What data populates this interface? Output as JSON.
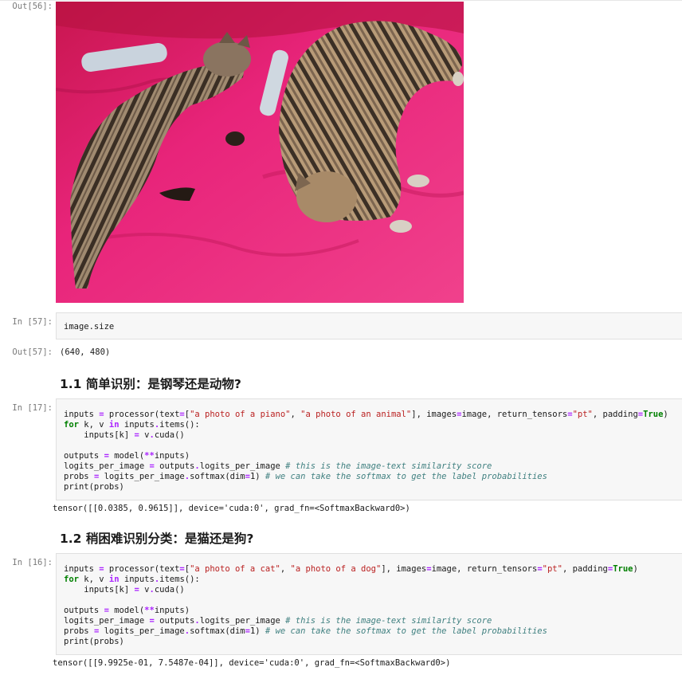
{
  "colors": {
    "prompt": "#7a7a7a",
    "code_bg": "#f7f7f7",
    "keyword": "#008000",
    "string": "#ba2121",
    "operator": "#aa22ff",
    "comment": "#408080",
    "blanket": "#e0216f"
  },
  "cells": {
    "out56": {
      "prompt": "Out[56]:",
      "image_alt": "two tabby cats lying on a pink blanket with two remote controls"
    },
    "in57": {
      "prompt": "In [57]:",
      "code": "image.size"
    },
    "out57": {
      "prompt": "Out[57]:",
      "text": "(640, 480)"
    },
    "heading1": {
      "text": "1.1 简单识别：是钢琴还是动物?"
    },
    "in17": {
      "prompt": "In [17]:",
      "l1_a": "inputs ",
      "l1_b": "=",
      "l1_c": " processor(text",
      "l1_d": "=",
      "l1_e": "[",
      "l1_f": "\"a photo of a piano\"",
      "l1_g": ", ",
      "l1_h": "\"a photo of an animal\"",
      "l1_i": "], images",
      "l1_j": "=",
      "l1_k": "image, return_tensors",
      "l1_l": "=",
      "l1_m": "\"pt\"",
      "l1_n": ", padding",
      "l1_o": "=",
      "l1_p": "True",
      "l1_q": ")",
      "l2_a": "for",
      "l2_b": " k, v ",
      "l2_c": "in",
      "l2_d": " inputs",
      "l2_e": ".",
      "l2_f": "items():",
      "l3_a": "    inputs[k] ",
      "l3_b": "=",
      "l3_c": " v",
      "l3_d": ".",
      "l3_e": "cuda()",
      "l5_a": "outputs ",
      "l5_b": "=",
      "l5_c": " model(",
      "l5_d": "**",
      "l5_e": "inputs)",
      "l6_a": "logits_per_image ",
      "l6_b": "=",
      "l6_c": " outputs",
      "l6_d": ".",
      "l6_e": "logits_per_image ",
      "l6_f": "# this is the image-text similarity score",
      "l7_a": "probs ",
      "l7_b": "=",
      "l7_c": " logits_per_image",
      "l7_d": ".",
      "l7_e": "softmax(dim",
      "l7_f": "=",
      "l7_g": "1",
      "l7_h": ") ",
      "l7_i": "# we can take the softmax to get the label probabilities",
      "l8_a": "print",
      "l8_b": "(probs)"
    },
    "out17": {
      "text": "tensor([[0.0385, 0.9615]], device='cuda:0', grad_fn=<SoftmaxBackward0>)"
    },
    "heading2": {
      "text": "1.2 稍困难识别分类：是猫还是狗?"
    },
    "in16": {
      "prompt": "In [16]:",
      "l1_a": "inputs ",
      "l1_b": "=",
      "l1_c": " processor(text",
      "l1_d": "=",
      "l1_e": "[",
      "l1_f": "\"a photo of a cat\"",
      "l1_g": ", ",
      "l1_h": "\"a photo of a dog\"",
      "l1_i": "], images",
      "l1_j": "=",
      "l1_k": "image, return_tensors",
      "l1_l": "=",
      "l1_m": "\"pt\"",
      "l1_n": ", padding",
      "l1_o": "=",
      "l1_p": "True",
      "l1_q": ")",
      "l2_a": "for",
      "l2_b": " k, v ",
      "l2_c": "in",
      "l2_d": " inputs",
      "l2_e": ".",
      "l2_f": "items():",
      "l3_a": "    inputs[k] ",
      "l3_b": "=",
      "l3_c": " v",
      "l3_d": ".",
      "l3_e": "cuda()",
      "l5_a": "outputs ",
      "l5_b": "=",
      "l5_c": " model(",
      "l5_d": "**",
      "l5_e": "inputs)",
      "l6_a": "logits_per_image ",
      "l6_b": "=",
      "l6_c": " outputs",
      "l6_d": ".",
      "l6_e": "logits_per_image ",
      "l6_f": "# this is the image-text similarity score",
      "l7_a": "probs ",
      "l7_b": "=",
      "l7_c": " logits_per_image",
      "l7_d": ".",
      "l7_e": "softmax(dim",
      "l7_f": "=",
      "l7_g": "1",
      "l7_h": ") ",
      "l7_i": "# we can take the softmax to get the label probabilities",
      "l8_a": "print",
      "l8_b": "(probs)"
    },
    "out16": {
      "text": "tensor([[9.9925e-01, 7.5487e-04]], device='cuda:0', grad_fn=<SoftmaxBackward0>)"
    }
  }
}
